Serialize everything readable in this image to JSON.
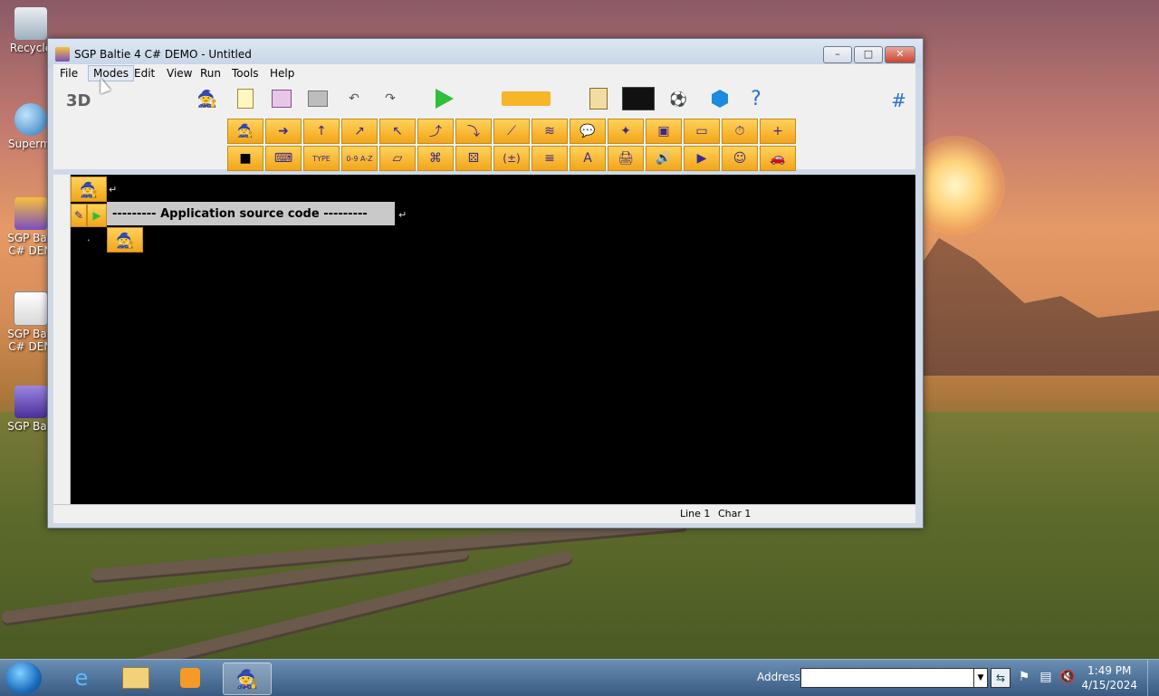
{
  "desktop": {
    "icons": [
      {
        "label": "Recycle",
        "icon": "recycle-bin-icon"
      },
      {
        "label": "Supermi",
        "icon": "globe-icon"
      },
      {
        "label": "SGP Balt\nC# DEM",
        "icon": "wizard-icon"
      },
      {
        "label": "SGP Balt\nC# DEM",
        "icon": "document-icon"
      },
      {
        "label": "SGP Balt",
        "icon": "wizard-icon"
      }
    ]
  },
  "window": {
    "title": "SGP Baltie 4 C# DEMO - Untitled",
    "controls": {
      "minimize": "–",
      "maximize": "□",
      "close": "✕"
    }
  },
  "menu": [
    "File",
    "Modes",
    "Edit",
    "View",
    "Run",
    "Tools",
    "Help"
  ],
  "toolbar": {
    "mode_label": "3D",
    "hash_label": "#",
    "help_label": "?",
    "top_icons": [
      "wizard-icon",
      "new-file-icon",
      "open-icon",
      "print-icon",
      "undo-icon",
      "redo-icon",
      "run-icon",
      "arrow-block-icon",
      "pages-icon",
      "screen-icon",
      "objects-icon",
      "cube-icon",
      "help-icon"
    ],
    "command_row_1": [
      "🧙",
      "➜",
      "↑",
      "↗",
      "↖",
      "⤴",
      "⤵",
      "⟋",
      "≋",
      "💬",
      "✦",
      "▣",
      "▭",
      "⏱",
      "+"
    ],
    "command_row_2": [
      "■",
      "⌨",
      "TYPE",
      "0-9 A-Z",
      "▱",
      "⌘",
      "⚄",
      "(±)",
      "≡",
      "A",
      "🖨",
      "🔊",
      "▶",
      "☺",
      "🚗"
    ]
  },
  "editor": {
    "comment_text": "--------- Application source code ---------",
    "return_symbol": "↵",
    "dot": "·"
  },
  "statusbar": {
    "line": "Line 1",
    "char": "Char 1"
  },
  "taskbar": {
    "address_label": "Address",
    "address_value": "",
    "time": "1:49 PM",
    "date": "4/15/2024"
  }
}
